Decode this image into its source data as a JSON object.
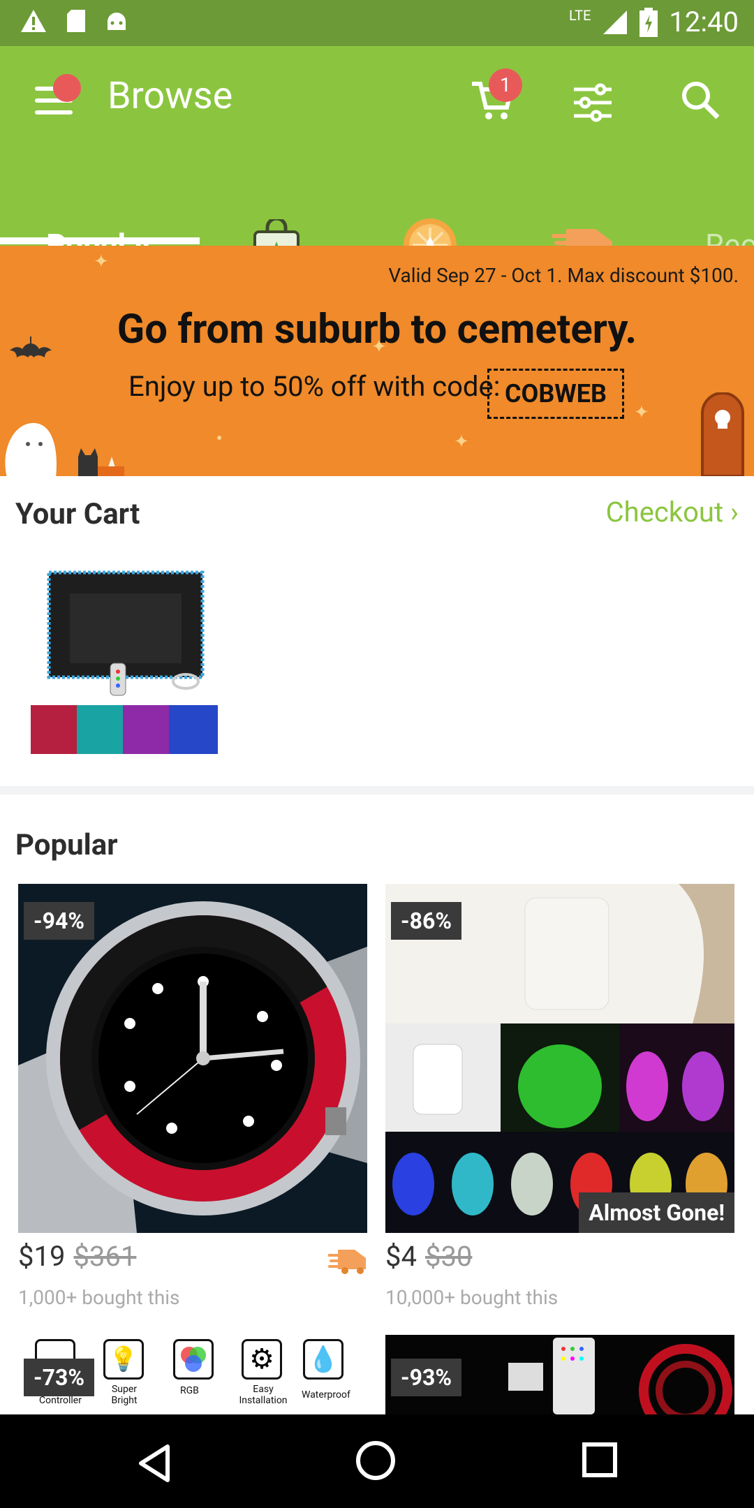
{
  "status": {
    "network": "LTE",
    "time": "12:40"
  },
  "appbar": {
    "title": "Browse",
    "cart_count": "1"
  },
  "tabs": {
    "popular": "Popular",
    "rec": "Rec"
  },
  "banner": {
    "valid": "Valid Sep 27 - Oct 1. Max discount $100.",
    "headline": "Go from suburb to cemetery.",
    "offer": "Enjoy up to 50% off with code:",
    "code": "COBWEB"
  },
  "cart": {
    "title": "Your Cart",
    "checkout": "Checkout ›"
  },
  "popular": {
    "title": "Popular",
    "items": [
      {
        "discount": "-94%",
        "price": "$19",
        "old_price": "$361",
        "bought": "1,000+ bought this"
      },
      {
        "discount": "-86%",
        "price": "$4",
        "old_price": "$30",
        "bought": "10,000+ bought this",
        "tag": "Almost Gone!"
      },
      {
        "discount": "-73%"
      },
      {
        "discount": "-93%"
      }
    ],
    "features": [
      "Controller",
      "Super Bright",
      "RGB",
      "Easy Installation",
      "Waterproof"
    ]
  }
}
